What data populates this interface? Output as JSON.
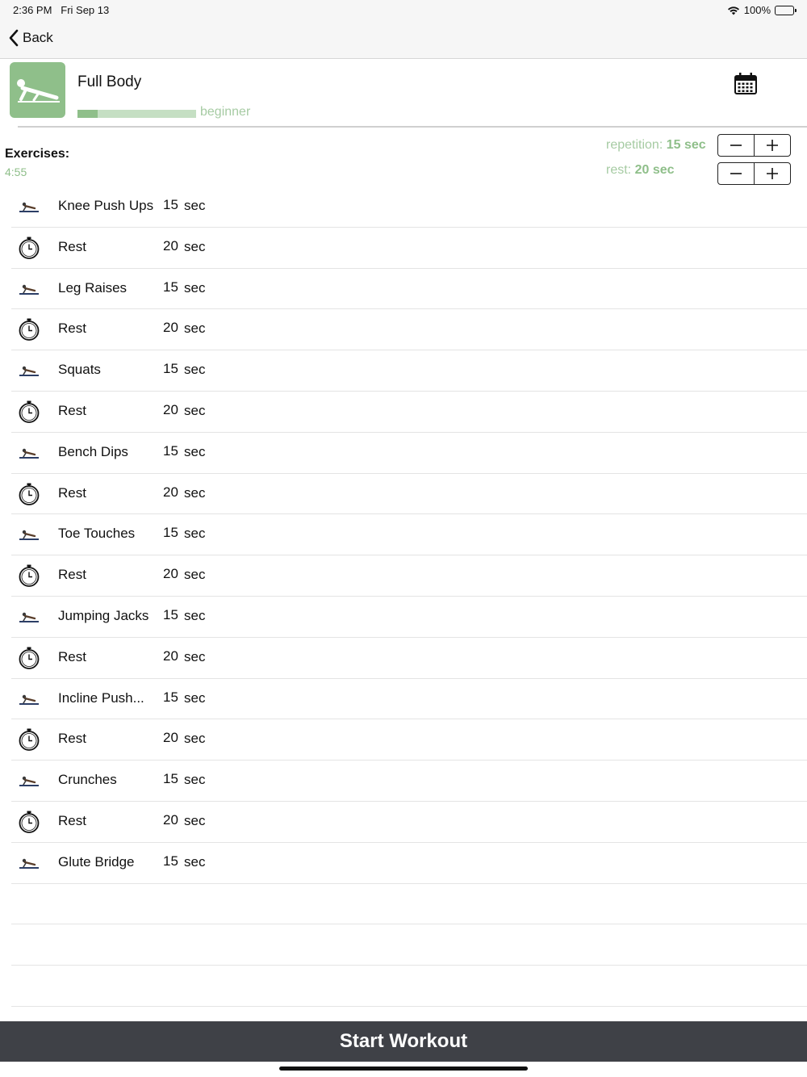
{
  "status_bar": {
    "time": "2:36 PM",
    "date": "Fri Sep 13",
    "battery": "100%"
  },
  "nav": {
    "back_label": "Back"
  },
  "workout": {
    "title": "Full Body",
    "level": "beginner",
    "level_progress": 0.17
  },
  "exercises_header": {
    "label": "Exercises:",
    "total_time": "4:55"
  },
  "settings": {
    "repetition_label": "repetition:",
    "repetition_value": "15",
    "repetition_unit": "sec",
    "rest_label": "rest:",
    "rest_value": "20 sec"
  },
  "exercises": [
    {
      "name": "Knee Push Ups",
      "duration": "15",
      "unit": "sec",
      "icon": "exercise-figure-icon"
    },
    {
      "name": "Rest",
      "duration": "20",
      "unit": "sec",
      "icon": "stopwatch-icon"
    },
    {
      "name": "Leg Raises",
      "duration": "15",
      "unit": "sec",
      "icon": "exercise-figure-icon"
    },
    {
      "name": "Rest",
      "duration": "20",
      "unit": "sec",
      "icon": "stopwatch-icon"
    },
    {
      "name": "Squats",
      "duration": "15",
      "unit": "sec",
      "icon": "exercise-figure-icon"
    },
    {
      "name": "Rest",
      "duration": "20",
      "unit": "sec",
      "icon": "stopwatch-icon"
    },
    {
      "name": "Bench Dips",
      "duration": "15",
      "unit": "sec",
      "icon": "exercise-figure-icon"
    },
    {
      "name": "Rest",
      "duration": "20",
      "unit": "sec",
      "icon": "stopwatch-icon"
    },
    {
      "name": "Toe Touches",
      "duration": "15",
      "unit": "sec",
      "icon": "exercise-figure-icon"
    },
    {
      "name": "Rest",
      "duration": "20",
      "unit": "sec",
      "icon": "stopwatch-icon"
    },
    {
      "name": "Jumping Jacks",
      "duration": "15",
      "unit": "sec",
      "icon": "exercise-figure-icon"
    },
    {
      "name": "Rest",
      "duration": "20",
      "unit": "sec",
      "icon": "stopwatch-icon"
    },
    {
      "name": "Incline Push...",
      "duration": "15",
      "unit": "sec",
      "icon": "exercise-figure-icon"
    },
    {
      "name": "Rest",
      "duration": "20",
      "unit": "sec",
      "icon": "stopwatch-icon"
    },
    {
      "name": "Crunches",
      "duration": "15",
      "unit": "sec",
      "icon": "exercise-figure-icon"
    },
    {
      "name": "Rest",
      "duration": "20",
      "unit": "sec",
      "icon": "stopwatch-icon"
    },
    {
      "name": "Glute Bridge",
      "duration": "15",
      "unit": "sec",
      "icon": "exercise-figure-icon"
    }
  ],
  "empty_rows": 3,
  "start_button": {
    "label": "Start Workout"
  },
  "colors": {
    "accent": "#8fbf8a",
    "accent_light": "#a6cba3",
    "button_bg": "#3f4147",
    "nav_bg": "#f6f6f6"
  }
}
